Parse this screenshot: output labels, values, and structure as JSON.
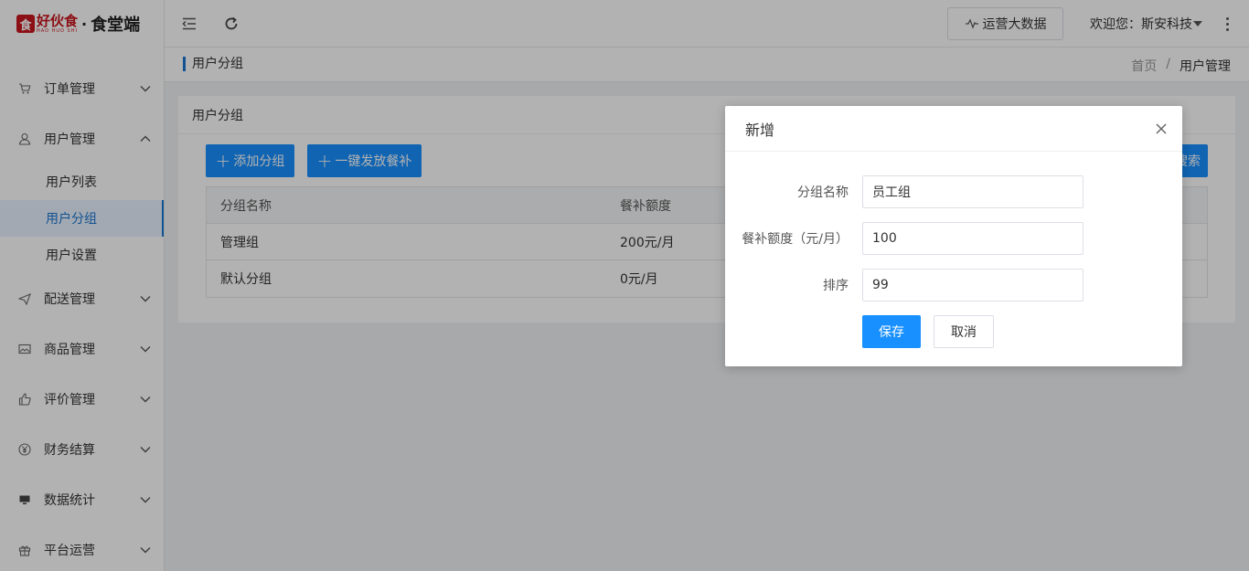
{
  "logo": {
    "mark": "食",
    "brand_cn": "好伙食",
    "brand_en": "HAO HUO SHI",
    "separator": "·",
    "title": "食堂端"
  },
  "sidebar": {
    "items": [
      {
        "label": "订单管理",
        "icon": "cart-icon",
        "expanded": false
      },
      {
        "label": "用户管理",
        "icon": "user-icon",
        "expanded": true,
        "children": [
          {
            "label": "用户列表",
            "active": false
          },
          {
            "label": "用户分组",
            "active": true
          },
          {
            "label": "用户设置",
            "active": false
          }
        ]
      },
      {
        "label": "配送管理",
        "icon": "send-icon",
        "expanded": false
      },
      {
        "label": "商品管理",
        "icon": "image-icon",
        "expanded": false
      },
      {
        "label": "评价管理",
        "icon": "thumb-up-icon",
        "expanded": false
      },
      {
        "label": "财务结算",
        "icon": "yen-icon",
        "expanded": false
      },
      {
        "label": "数据统计",
        "icon": "monitor-icon",
        "expanded": false
      },
      {
        "label": "平台运营",
        "icon": "gift-icon",
        "expanded": false
      }
    ]
  },
  "topbar": {
    "bigdata_label": "运营大数据",
    "welcome": "欢迎您：斯安科技"
  },
  "breadcrumb": {
    "title": "用户分组",
    "path": [
      "首页",
      "用户管理"
    ],
    "separator": "/"
  },
  "card": {
    "title": "用户分组",
    "add_group_label": "添加分组",
    "issue_subsidy_label": "一键发放餐补",
    "search_label_partial": "搜索",
    "table": {
      "headers": [
        "分组名称",
        "餐补额度"
      ],
      "rows": [
        [
          "管理组",
          "200元/月"
        ],
        [
          "默认分组",
          "0元/月"
        ]
      ]
    }
  },
  "modal": {
    "title": "新增",
    "fields": [
      {
        "label": "分组名称",
        "value": "员工组"
      },
      {
        "label": "餐补额度（元/月）",
        "value": "100"
      },
      {
        "label": "排序",
        "value": "99"
      }
    ],
    "save_label": "保存",
    "cancel_label": "取消"
  },
  "colors": {
    "primary": "#1890ff",
    "brand": "#c8161d",
    "active_text": "#1976d2"
  }
}
